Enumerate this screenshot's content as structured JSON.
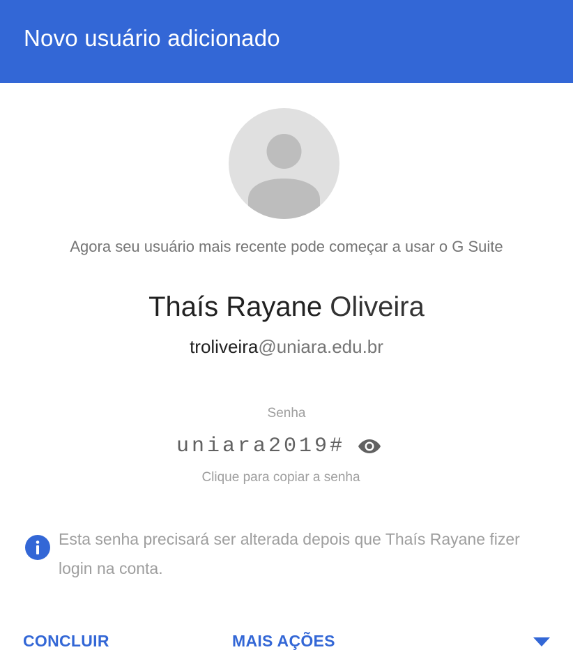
{
  "dialog": {
    "title": "Novo usuário adicionado"
  },
  "content": {
    "avatar_icon": "default-person-avatar",
    "subtitle": "Agora seu usuário mais recente pode começar a usar o G Suite",
    "user": {
      "first_names": "Thaís Rayane",
      "last_name": "Oliveira",
      "email_local": "troliveira",
      "email_domain": "@uniara.edu.br"
    },
    "password": {
      "label": "Senha",
      "value": "uniara2019#",
      "visibility_icon": "eye-icon",
      "copy_hint": "Clique para copiar a senha"
    },
    "notice": {
      "icon": "info-icon",
      "text": "Esta senha precisará ser alterada depois que Thaís Rayane fizer login na conta."
    }
  },
  "actions": {
    "done_label": "CONCLUIR",
    "more_label": "MAIS AÇÕES",
    "more_icon": "caret-down-icon"
  },
  "colors": {
    "accent": "#3367d6",
    "header_bg": "#3367d6",
    "avatar_bg": "#e0e0e0",
    "avatar_fg": "#bdbdbd"
  }
}
